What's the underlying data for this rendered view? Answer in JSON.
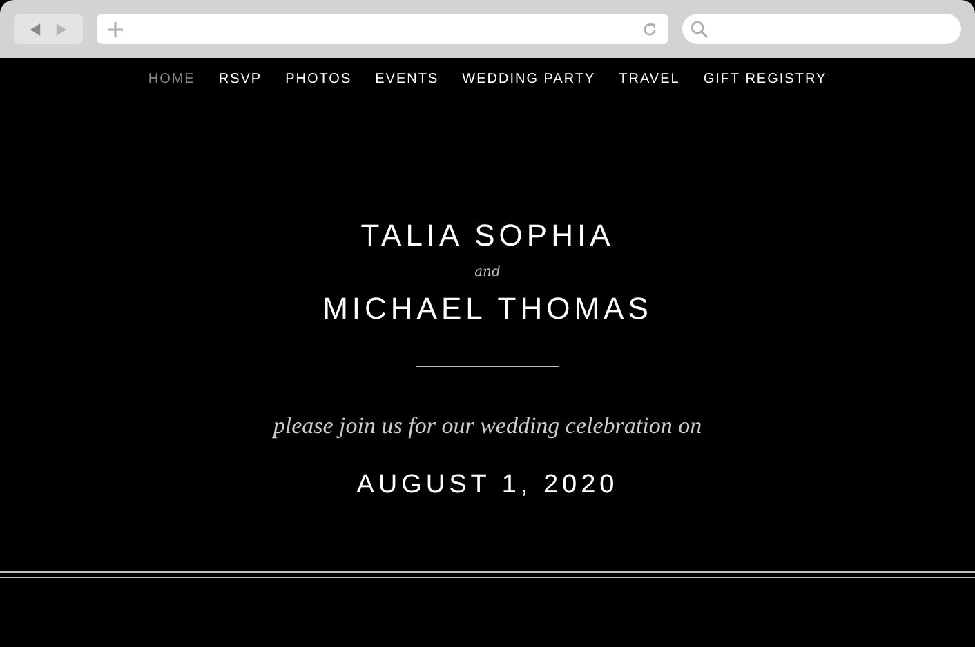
{
  "nav": [
    {
      "label": "HOME",
      "selected": true
    },
    {
      "label": "RSVP",
      "selected": false
    },
    {
      "label": "PHOTOS",
      "selected": false
    },
    {
      "label": "EVENTS",
      "selected": false
    },
    {
      "label": "WEDDING PARTY",
      "selected": false
    },
    {
      "label": "TRAVEL",
      "selected": false
    },
    {
      "label": "GIFT REGISTRY",
      "selected": false
    }
  ],
  "hero": {
    "name_1": "TALIA SOPHIA",
    "connector": "and",
    "name_2": "MICHAEL THOMAS",
    "invitation": "please join us for our wedding celebration on",
    "date": "AUGUST 1, 2020"
  }
}
